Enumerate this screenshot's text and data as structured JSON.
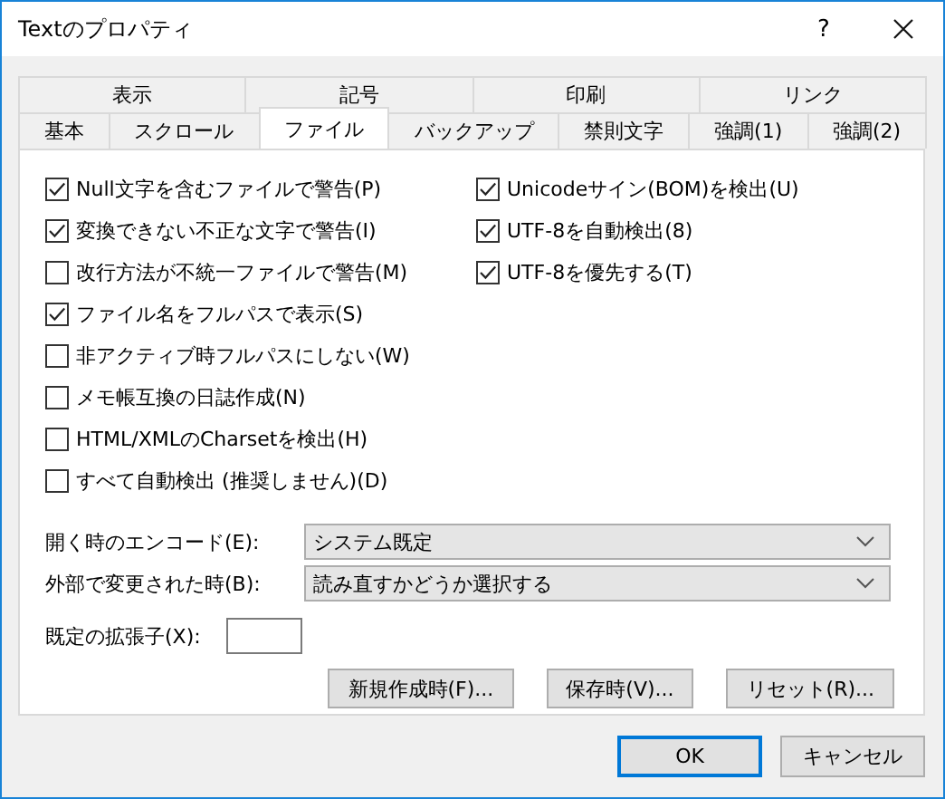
{
  "window": {
    "title": "Textのプロパティ",
    "help": "?"
  },
  "tabs_back_row": [
    {
      "label": "表示",
      "selected": false
    },
    {
      "label": "記号",
      "selected": false
    },
    {
      "label": "印刷",
      "selected": false
    },
    {
      "label": "リンク",
      "selected": false
    }
  ],
  "tabs_front_row": [
    {
      "label": "基本",
      "selected": false
    },
    {
      "label": "スクロール",
      "selected": false
    },
    {
      "label": "ファイル",
      "selected": true
    },
    {
      "label": "バックアップ",
      "selected": false
    },
    {
      "label": "禁則文字",
      "selected": false
    },
    {
      "label": "強調(1)",
      "selected": false
    },
    {
      "label": "強調(2)",
      "selected": false
    }
  ],
  "options_left": [
    {
      "label": "Null文字を含むファイルで警告(P)",
      "checked": true
    },
    {
      "label": "変換できない不正な文字で警告(I)",
      "checked": true
    },
    {
      "label": "改行方法が不統一ファイルで警告(M)",
      "checked": false
    },
    {
      "label": "ファイル名をフルパスで表示(S)",
      "checked": true
    },
    {
      "label": "非アクティブ時フルパスにしない(W)",
      "checked": false
    },
    {
      "label": "メモ帳互換の日誌作成(N)",
      "checked": false
    },
    {
      "label": "HTML/XMLのCharsetを検出(H)",
      "checked": false
    },
    {
      "label": "すべて自動検出 (推奨しません)(D)",
      "checked": false
    }
  ],
  "options_right": [
    {
      "label": "Unicodeサイン(BOM)を検出(U)",
      "checked": true
    },
    {
      "label": "UTF-8を自動検出(8)",
      "checked": true
    },
    {
      "label": "UTF-8を優先する(T)",
      "checked": true
    }
  ],
  "dropdowns": [
    {
      "label": "開く時のエンコード(E):",
      "value": "システム既定"
    },
    {
      "label": "外部で変更された時(B):",
      "value": "読み直すかどうか選択する"
    }
  ],
  "extension": {
    "label": "既定の拡張子(X):"
  },
  "panel_buttons": [
    "新規作成時(F)...",
    "保存時(V)...",
    "リセット(R)..."
  ],
  "dialog_buttons": [
    {
      "label": "OK",
      "default": true
    },
    {
      "label": "キャンセル",
      "default": false
    }
  ]
}
